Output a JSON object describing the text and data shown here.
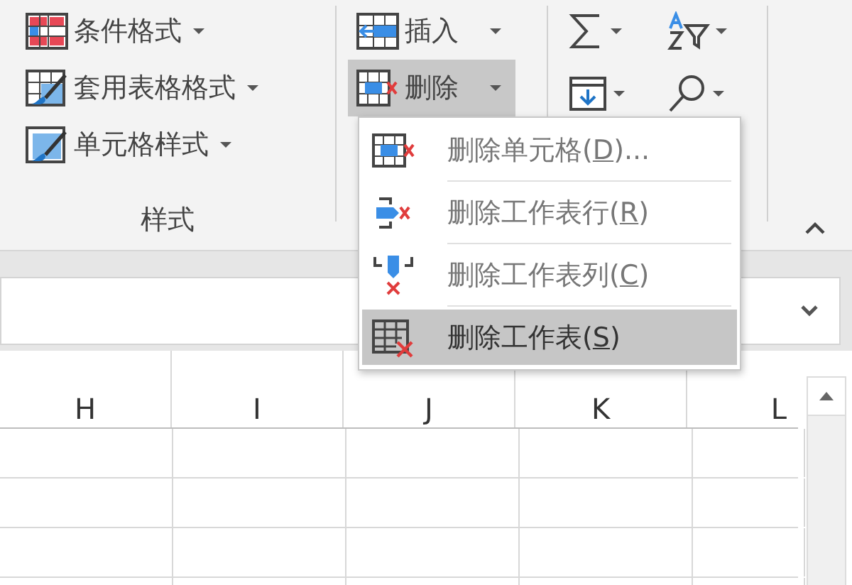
{
  "ribbon": {
    "styles_group": {
      "label": "样式",
      "items": [
        {
          "kind": "conditional",
          "label": "条件格式"
        },
        {
          "kind": "table",
          "label": "套用表格格式"
        },
        {
          "kind": "cellstyle",
          "label": "单元格样式"
        }
      ]
    },
    "cells_group": {
      "items": [
        {
          "kind": "insert",
          "label": "插入",
          "pressed": false
        },
        {
          "kind": "delete",
          "label": "删除",
          "pressed": true
        }
      ]
    },
    "editing_group": {
      "items": [
        {
          "kind": "sum"
        },
        {
          "kind": "sort"
        },
        {
          "kind": "fill"
        },
        {
          "kind": "find"
        }
      ]
    }
  },
  "delete_menu": {
    "items": [
      {
        "kind": "cells",
        "text": "删除单元格(",
        "key": "D",
        "suffix": ")...",
        "selected": false
      },
      {
        "kind": "rows",
        "text": "删除工作表行(",
        "key": "R",
        "suffix": ")",
        "selected": false
      },
      {
        "kind": "columns",
        "text": "删除工作表列(",
        "key": "C",
        "suffix": ")",
        "selected": false
      },
      {
        "kind": "sheet",
        "text": "删除工作表(",
        "key": "S",
        "suffix": ")",
        "selected": true
      }
    ]
  },
  "columns": [
    "H",
    "I",
    "J",
    "K",
    "L"
  ]
}
